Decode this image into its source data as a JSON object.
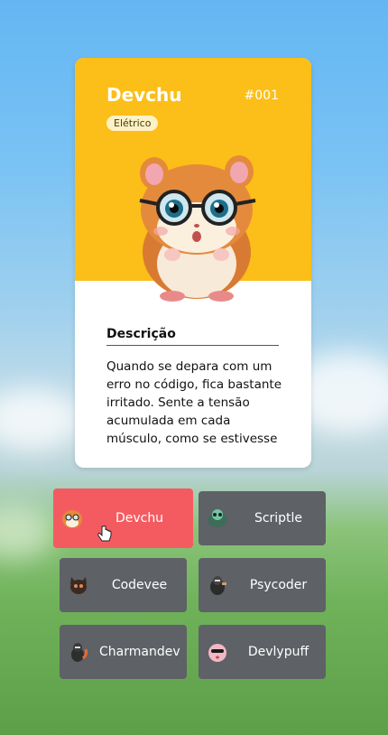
{
  "card": {
    "name": "Devchu",
    "number": "#001",
    "type": "Elétrico",
    "description_title": "Descrição",
    "description": "Quando se depara com um erro no código, fica bastante irritado. Sente a tensão acumulada em cada músculo, como se estivesse",
    "accent_color": "#fcbe18"
  },
  "characters": [
    {
      "name": "Devchu",
      "icon": "hamster-avatar-icon",
      "selected": true
    },
    {
      "name": "Scriptle",
      "icon": "turtle-avatar-icon",
      "selected": false
    },
    {
      "name": "Codevee",
      "icon": "fox-avatar-icon",
      "selected": false
    },
    {
      "name": "Psycoder",
      "icon": "duck-avatar-icon",
      "selected": false
    },
    {
      "name": "Charmandev",
      "icon": "lizard-avatar-icon",
      "selected": false
    },
    {
      "name": "Devlypuff",
      "icon": "puff-avatar-icon",
      "selected": false
    }
  ],
  "colors": {
    "selected_button": "#f45b61",
    "button": "#5e6166"
  }
}
